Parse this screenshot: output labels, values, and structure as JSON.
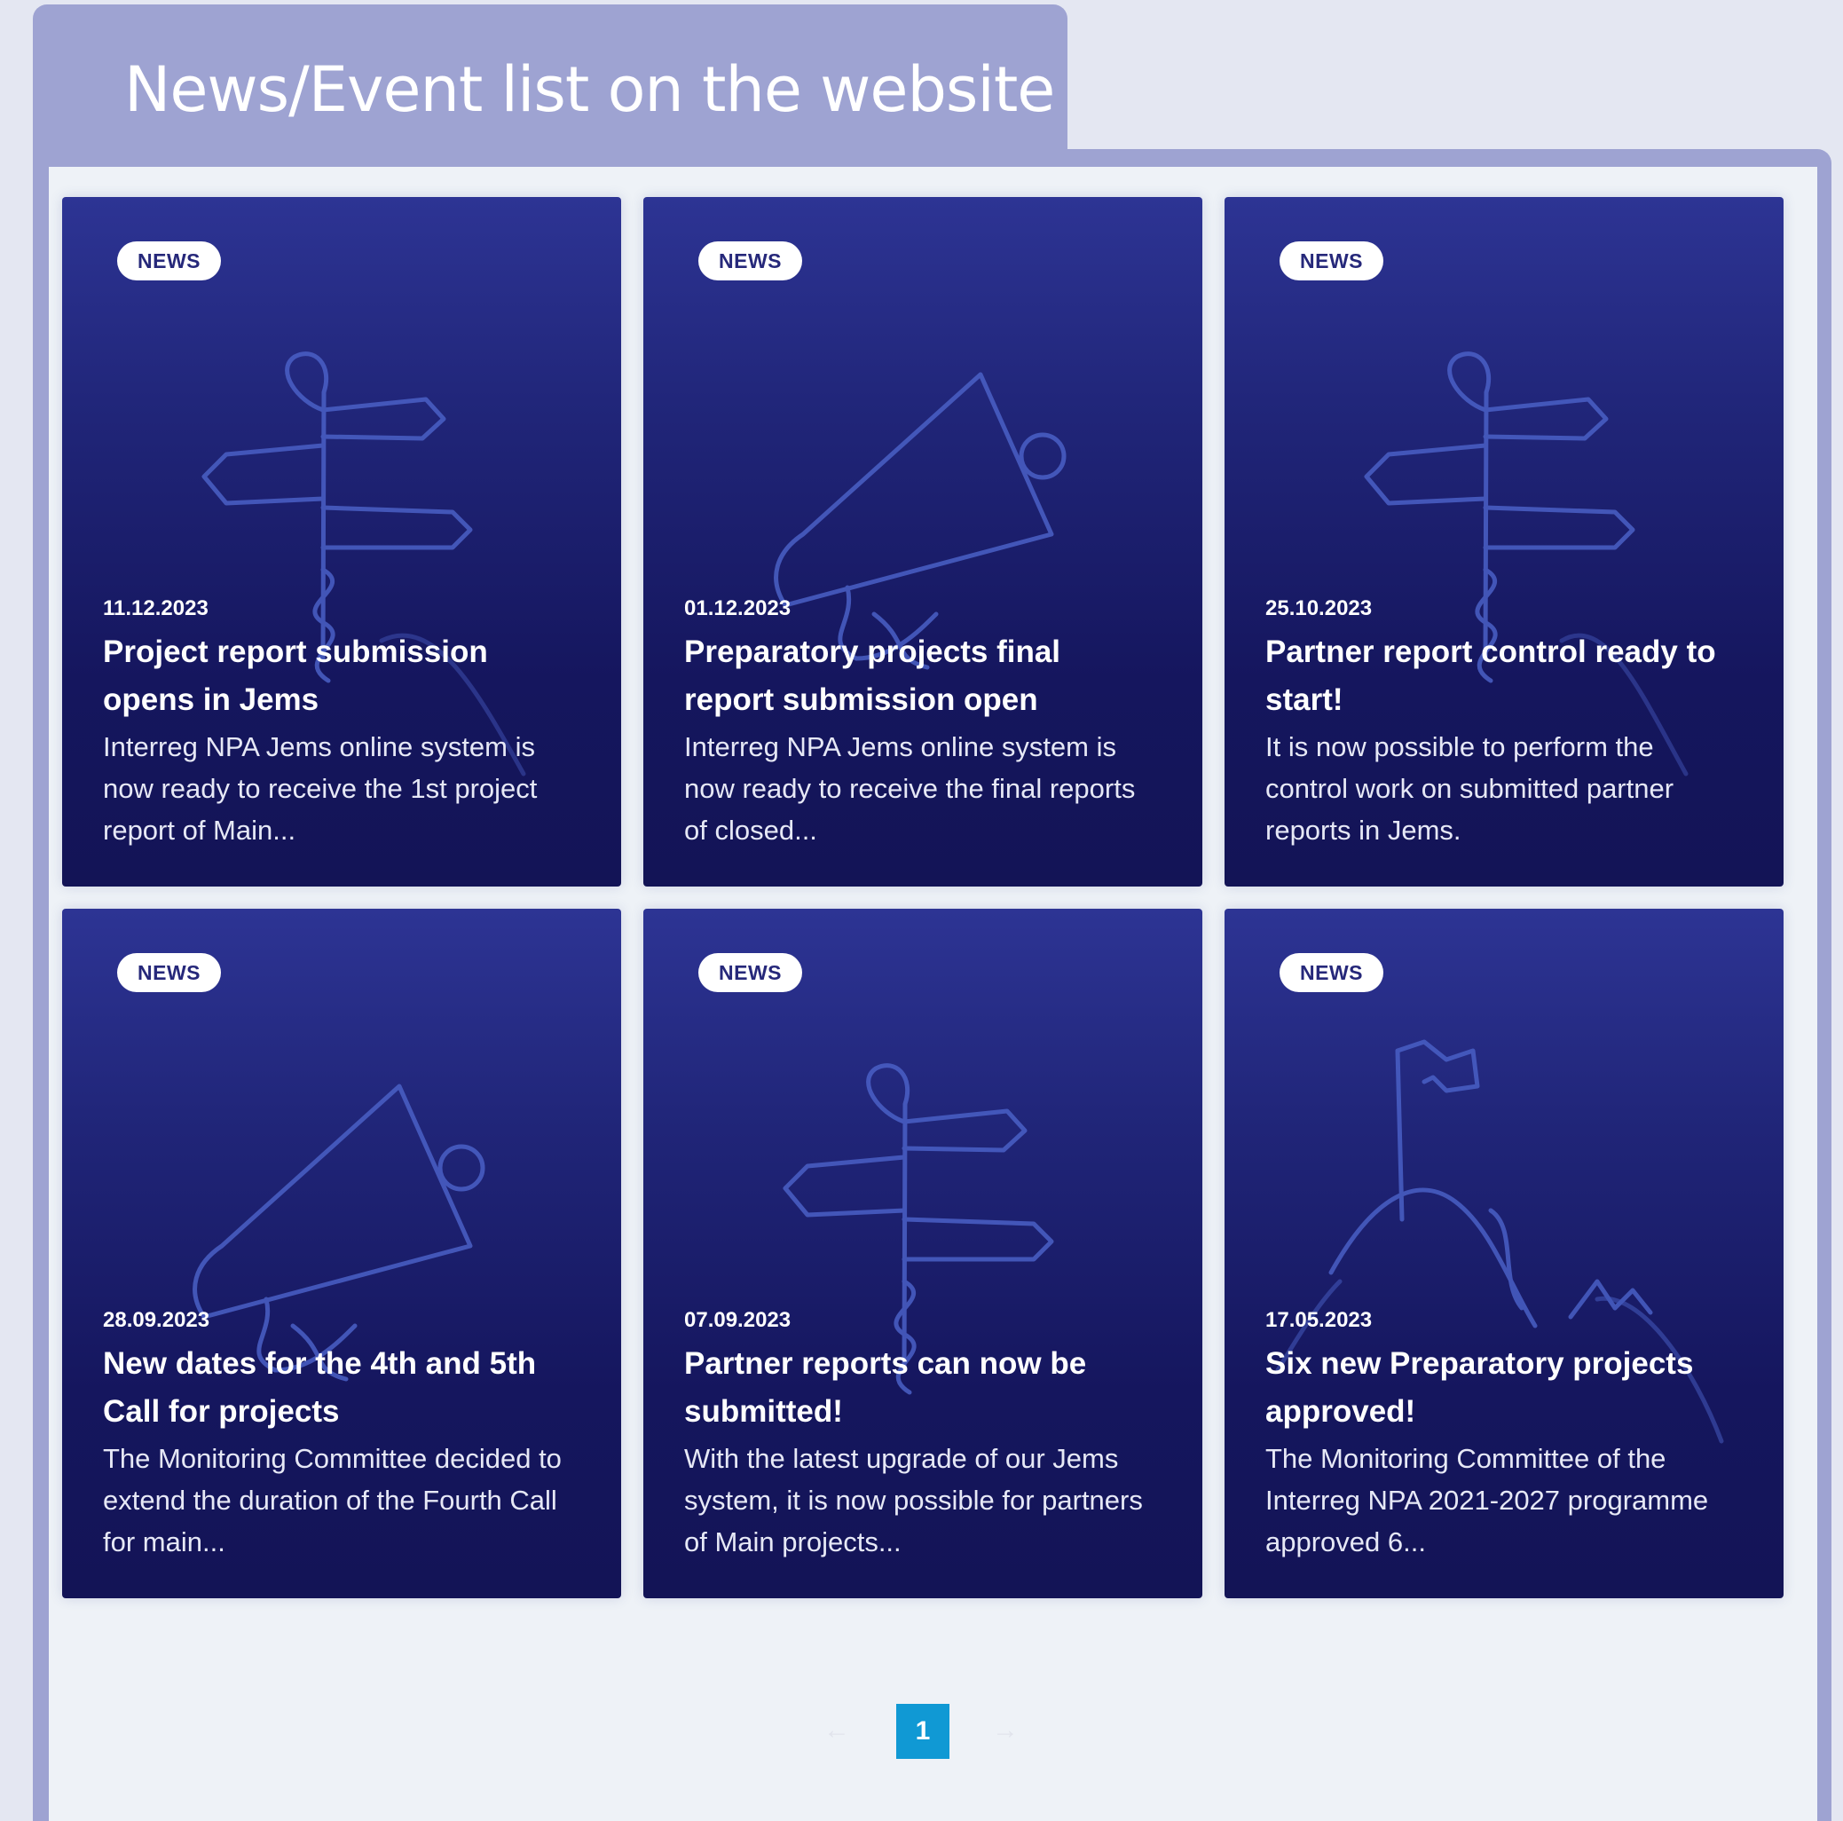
{
  "page": {
    "title": "News/Event list on the website"
  },
  "cards": [
    {
      "badge": "NEWS",
      "date": "11.12.2023",
      "title": "Project report submission opens in Jems",
      "excerpt": "Interreg NPA Jems online system is now ready to receive the 1st project report of Main...",
      "illustration": "signpost-icon"
    },
    {
      "badge": "NEWS",
      "date": "01.12.2023",
      "title": "Preparatory projects final report submission open",
      "excerpt": "Interreg NPA Jems online system is now ready to receive the final reports of closed...",
      "illustration": "megaphone-icon"
    },
    {
      "badge": "NEWS",
      "date": "25.10.2023",
      "title": "Partner report control ready to start!",
      "excerpt": "It is now possible to perform the control work on submitted partner reports in Jems.",
      "illustration": "signpost-icon"
    },
    {
      "badge": "NEWS",
      "date": "28.09.2023",
      "title": "New dates for the 4th and 5th Call for projects",
      "excerpt": "The Monitoring Committee decided to extend the duration of the Fourth Call for main...",
      "illustration": "megaphone-icon"
    },
    {
      "badge": "NEWS",
      "date": "07.09.2023",
      "title": "Partner reports can now be submitted!",
      "excerpt": "With the latest upgrade of our Jems system, it is now possible for partners of Main projects...",
      "illustration": "signpost-icon"
    },
    {
      "badge": "NEWS",
      "date": "17.05.2023",
      "title": "Six new Preparatory projects approved!",
      "excerpt": "The Monitoring Committee of the Interreg NPA 2021-2027 programme approved 6...",
      "illustration": "flag-mountain-icon"
    }
  ],
  "pagination": {
    "prev": "←",
    "current": "1",
    "next": "→"
  },
  "colors": {
    "frame": "#9ea3d2",
    "card_top": "#2d3494",
    "card_bottom": "#131456",
    "pager_active": "#1099d4"
  }
}
